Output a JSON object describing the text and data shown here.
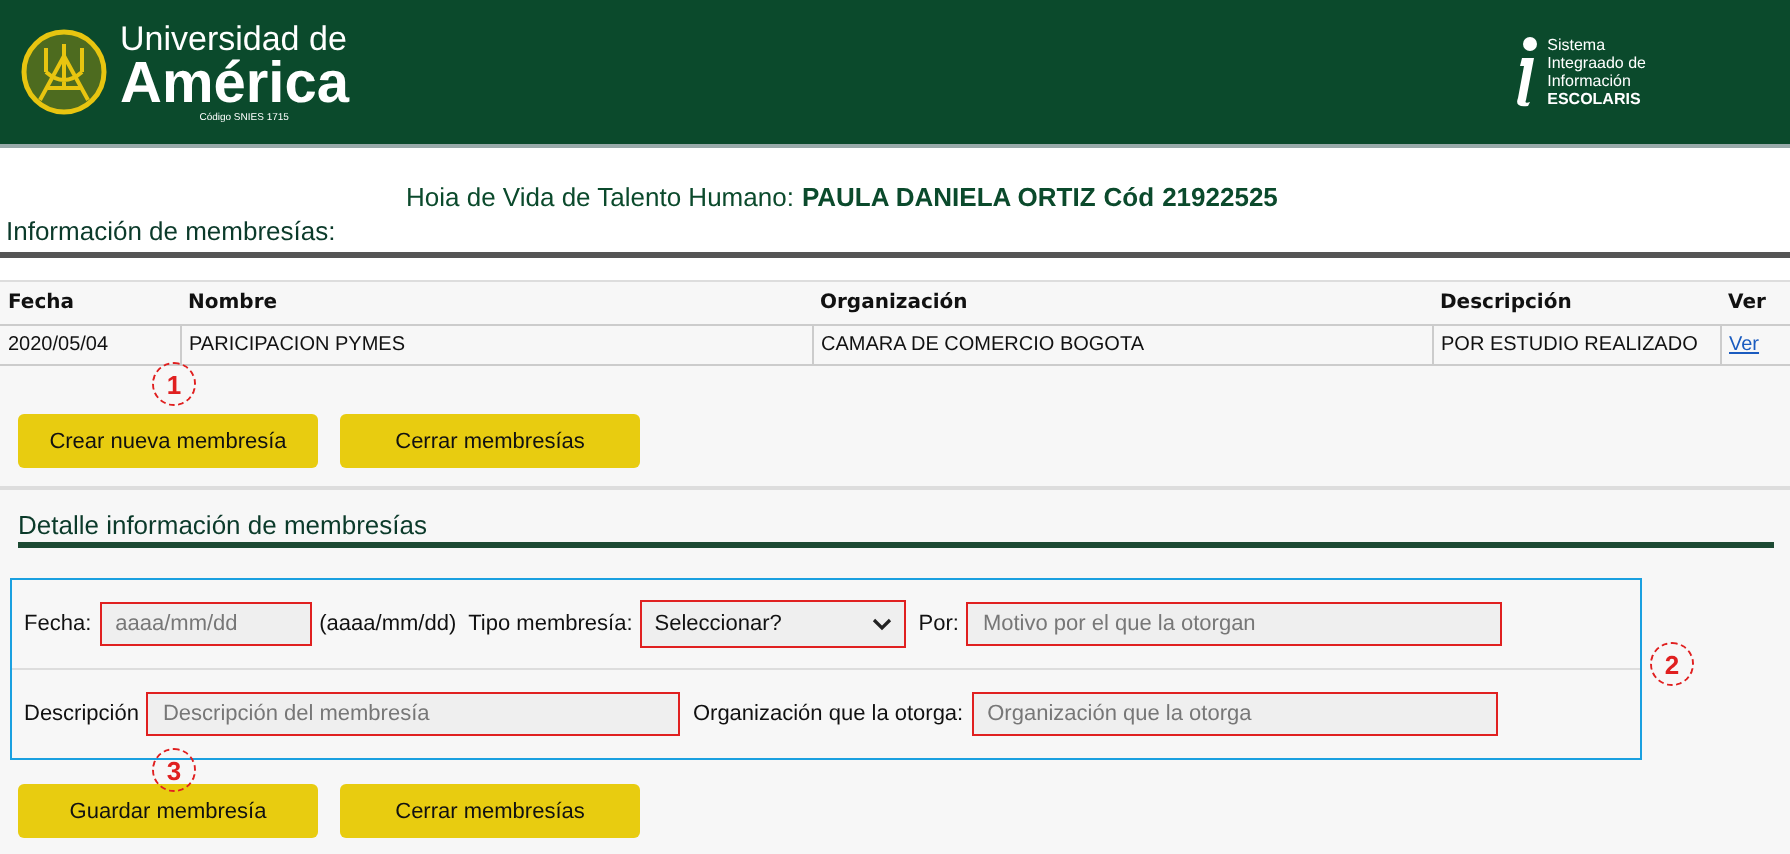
{
  "header": {
    "logo_top": "Universidad de",
    "logo_main": "América",
    "logo_code": "Código SNIES 1715",
    "system_lines": [
      "Sistema",
      "Integraado de",
      "Información"
    ],
    "system_name": "ESCOLARIS"
  },
  "title": {
    "prefix": "Hoia de Vida de Talento Humano:",
    "name": "PAULA DANIELA ORTIZ",
    "code_label": "Cód",
    "code": "21922525"
  },
  "section_heading": "Información de membresías:",
  "table": {
    "columns": [
      "Fecha",
      "Nombre",
      "Organización",
      "Descripción",
      "Ver"
    ],
    "rows": [
      {
        "cells": [
          "2020/05/04",
          "PARICIPACION PYMES",
          "CAMARA DE COMERCIO BOGOTA",
          "POR ESTUDIO REALIZADO"
        ],
        "link": "Ver"
      }
    ]
  },
  "list_buttons": [
    "Crear nueva membresía",
    "Cerrar membresías"
  ],
  "detail": {
    "heading": "Detalle información de membresías",
    "rows": [
      [
        {
          "kind": "input",
          "label": "Fecha:",
          "placeholder": "aaaa/mm/dd",
          "hint": "(aaaa/mm/dd)"
        },
        {
          "kind": "select",
          "label": "Tipo membresía:",
          "value": "Seleccionar?"
        },
        {
          "kind": "input",
          "label": "Por:",
          "placeholder": "Motivo por el que la otorgan"
        }
      ],
      [
        {
          "kind": "input",
          "label": "Descripción",
          "placeholder": "Descripción del membresía"
        },
        {
          "kind": "input",
          "label": "Organización que la otorga:",
          "placeholder": "Organización que la otorga"
        }
      ]
    ],
    "buttons": [
      "Guardar membresía",
      "Cerrar membresías"
    ]
  },
  "callouts": [
    "1",
    "2",
    "3"
  ]
}
